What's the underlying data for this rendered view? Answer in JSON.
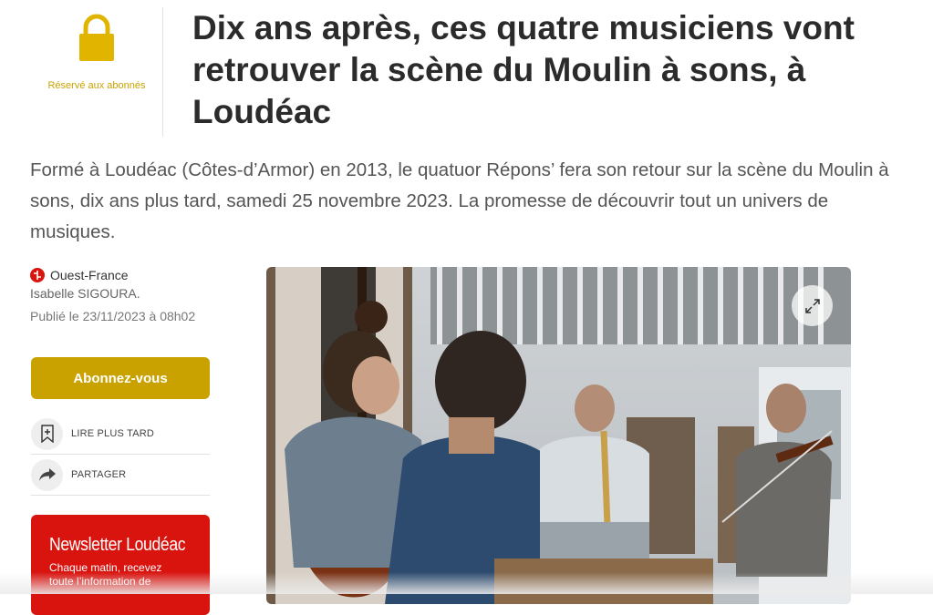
{
  "premium": {
    "label": "Réservé aux abonnés",
    "icon": "lock-icon",
    "color": "#c9a200"
  },
  "article": {
    "title": "Dix ans après, ces quatre musiciens vont retrouver la scène du Moulin à sons, à Loudéac",
    "lead": "Formé à Loudéac (Côtes-d’Armor) en 2013, le quatuor Répons’ fera son retour sur la scène du Moulin à sons, dix ans plus tard, samedi 25 novembre 2023. La promesse de découvrir tout un univers de musiques.",
    "source": "Ouest-France",
    "author": "Isabelle SIGOURA.",
    "published": "Publié le 23/11/2023 à 08h02"
  },
  "actions": {
    "subscribe_label": "Abonnez-vous",
    "read_later_label": "LIRE PLUS TARD",
    "share_label": "PARTAGER"
  },
  "newsletter": {
    "title": "Newsletter Loudéac",
    "description": "Chaque matin, recevez toute l’information de"
  },
  "photo": {
    "expand_icon": "expand-icon"
  },
  "colors": {
    "accent": "#c9a200",
    "brand_red": "#d9140f"
  }
}
